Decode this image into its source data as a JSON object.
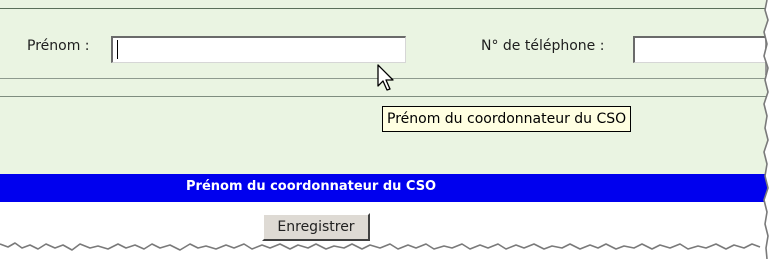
{
  "form": {
    "prenom_label": "Prénom :",
    "prenom_value": "",
    "telephone_label": "N° de téléphone :",
    "telephone_value": ""
  },
  "tooltip": {
    "text": "Prénom du coordonnateur du CSO"
  },
  "status_bar": {
    "text": "Prénom du coordonnateur du CSO",
    "background_color": "#0000ee",
    "text_color": "#ffffff"
  },
  "actions": {
    "save_label": "Enregistrer"
  },
  "colors": {
    "form_background": "#eaf4e2",
    "tooltip_background": "#ffffe1"
  },
  "icons": {
    "cursor": "mouse-pointer-icon"
  }
}
